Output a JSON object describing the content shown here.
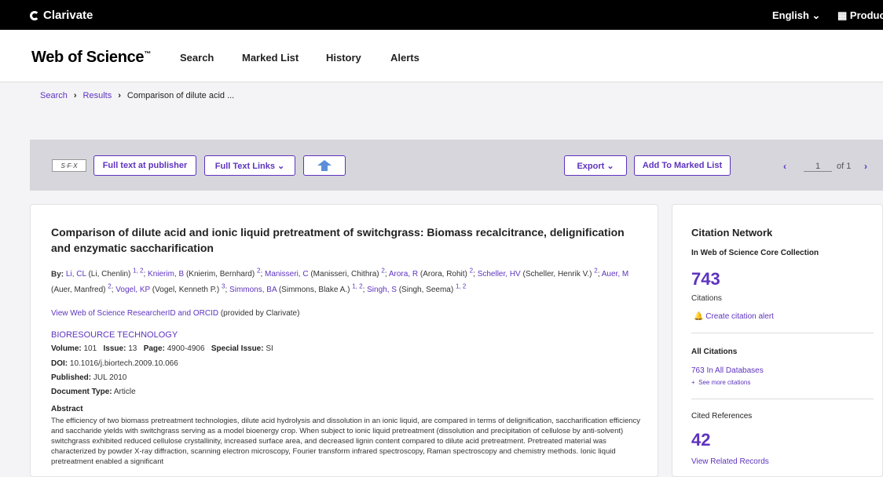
{
  "topbar": {
    "brand": "Clarivate",
    "lang": "English ⌄",
    "products": "Products"
  },
  "nav": {
    "logo": "Web of Science",
    "logo_tm": "™",
    "items": [
      "Search",
      "Marked List",
      "History",
      "Alerts"
    ]
  },
  "breadcrumb": {
    "search": "Search",
    "results": "Results",
    "current": "Comparison of dilute acid ...",
    "sep": "›"
  },
  "toolbar": {
    "sfx": "S·F·X",
    "full_text_publisher": "Full text at publisher",
    "full_text_links": "Full Text Links ⌄",
    "export": "Export ⌄",
    "add_marked": "Add To Marked List",
    "page": "1",
    "of": "of 1"
  },
  "record": {
    "title": "Comparison of dilute acid and ionic liquid pretreatment of switchgrass: Biomass recalcitrance, delignification and enzymatic saccharification",
    "by_label": "By:",
    "authors": [
      {
        "short": "Li, CL",
        "full": " (Li, Chenlin) ",
        "aff": "1, 2"
      },
      {
        "short": "Knierim, B",
        "full": " (Knierim, Bernhard) ",
        "aff": "2"
      },
      {
        "short": "Manisseri, C",
        "full": " (Manisseri, Chithra) ",
        "aff": "2"
      },
      {
        "short": "Arora, R",
        "full": " (Arora, Rohit) ",
        "aff": "2"
      },
      {
        "short": "Scheller, HV",
        "full": " (Scheller, Henrik V.) ",
        "aff": "2"
      },
      {
        "short": "Auer, M",
        "full": " (Auer, Manfred) ",
        "aff": "2"
      },
      {
        "short": "Vogel, KP",
        "full": " (Vogel, Kenneth P.) ",
        "aff": "3"
      },
      {
        "short": "Simmons, BA",
        "full": " (Simmons, Blake A.) ",
        "aff": "1, 2"
      },
      {
        "short": "Singh, S",
        "full": " (Singh, Seema) ",
        "aff": "1, 2"
      }
    ],
    "rid_link": "View Web of Science ResearcherID and ORCID",
    "rid_suffix": " (provided by Clarivate)",
    "journal": "BIORESOURCE TECHNOLOGY",
    "volume_label": "Volume:",
    "volume": "101",
    "issue_label": "Issue:",
    "issue": "13",
    "page_label": "Page:",
    "pages": "4900-4906",
    "special_label": "Special Issue:",
    "special": "SI",
    "doi_label": "DOI:",
    "doi": "10.1016/j.biortech.2009.10.066",
    "published_label": "Published:",
    "published": "JUL 2010",
    "doctype_label": "Document Type:",
    "doctype": "Article",
    "abstract_label": "Abstract",
    "abstract": "The efficiency of two biomass pretreatment technologies, dilute acid hydrolysis and dissolution in an ionic liquid, are compared in terms of delignification, saccharification efficiency and saccharide yields with switchgrass serving as a model bioenergy crop. When subject to ionic liquid pretreatment (dissolution and precipitation of cellulose by anti-solvent) switchgrass exhibited reduced cellulose crystallinity, increased surface area, and decreased lignin content compared to dilute acid pretreatment. Pretreated material was characterized by powder X-ray diffraction, scanning electron microscopy, Fourier transform infrared spectroscopy, Raman spectroscopy and chemistry methods. Ionic liquid pretreatment enabled a significant"
  },
  "citation_network": {
    "title": "Citation Network",
    "collection": "In Web of Science Core Collection",
    "citations_count": "743",
    "citations_label": "Citations",
    "create_alert": "Create citation alert",
    "all_citations_label": "All Citations",
    "all_db": "763 In All Databases",
    "see_more": "See more citations",
    "cited_refs_label": "Cited References",
    "cited_refs_count": "42",
    "related": "View Related Records"
  }
}
